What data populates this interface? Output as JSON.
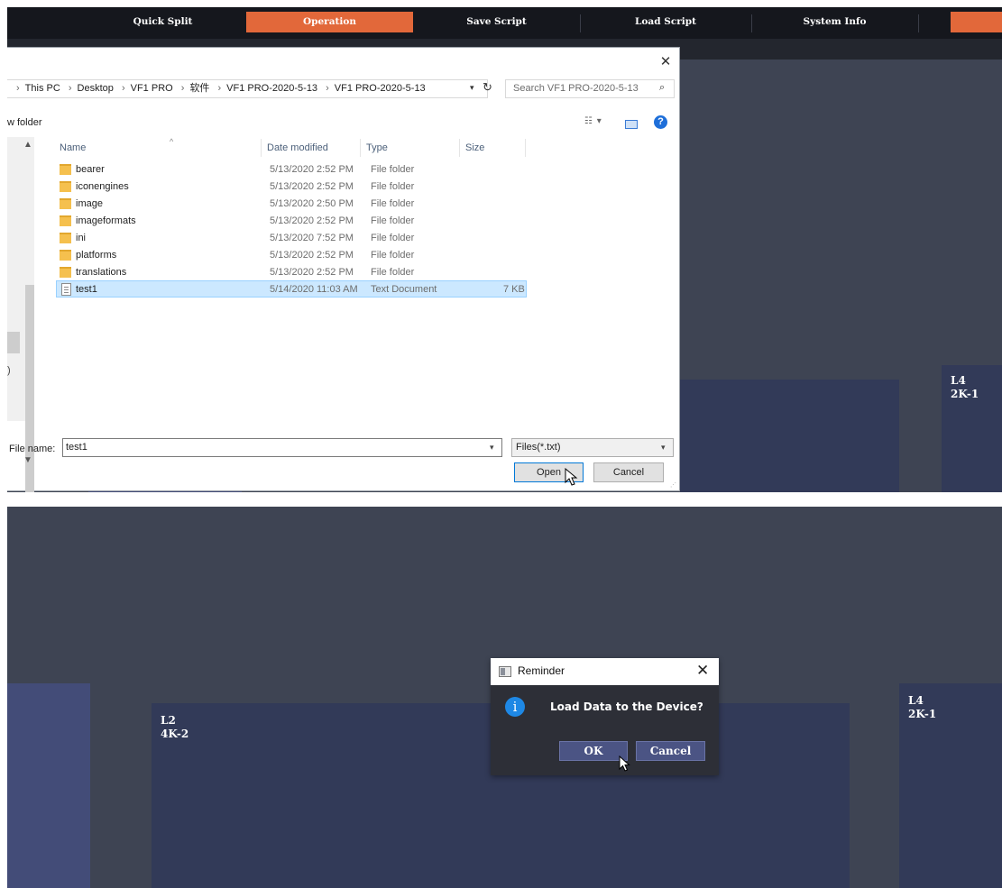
{
  "menu": {
    "tabs": [
      {
        "label": "Quick Split"
      },
      {
        "label": "Operation"
      },
      {
        "label": "Save Script"
      },
      {
        "label": "Load Script"
      },
      {
        "label": "System Info"
      }
    ]
  },
  "colors": {
    "accent": "#e2683a",
    "canvas": "#3e4453",
    "menubar": "#15171d",
    "layer_dark": "#323a58",
    "layer_light": "#434c78"
  },
  "top_layers": {
    "l4_label": "L4\n2K-1"
  },
  "file_dialog": {
    "breadcrumb": [
      "This PC",
      "Desktop",
      "VF1 PRO",
      "软件",
      "VF1 PRO-2020-5-13",
      "VF1 PRO-2020-5-13"
    ],
    "search_placeholder": "Search VF1 PRO-2020-5-13",
    "new_folder_label": "w folder",
    "nav_partial": ")",
    "columns": [
      "Name",
      "Date modified",
      "Type",
      "Size"
    ],
    "files": [
      {
        "name": "bearer",
        "date": "5/13/2020 2:52 PM",
        "type": "File folder",
        "size": "",
        "icon": "folder-icon"
      },
      {
        "name": "iconengines",
        "date": "5/13/2020 2:52 PM",
        "type": "File folder",
        "size": "",
        "icon": "folder-icon"
      },
      {
        "name": "image",
        "date": "5/13/2020 2:50 PM",
        "type": "File folder",
        "size": "",
        "icon": "folder-icon"
      },
      {
        "name": "imageformats",
        "date": "5/13/2020 2:52 PM",
        "type": "File folder",
        "size": "",
        "icon": "folder-icon"
      },
      {
        "name": "ini",
        "date": "5/13/2020 7:52 PM",
        "type": "File folder",
        "size": "",
        "icon": "folder-icon"
      },
      {
        "name": "platforms",
        "date": "5/13/2020 2:52 PM",
        "type": "File folder",
        "size": "",
        "icon": "folder-icon"
      },
      {
        "name": "translations",
        "date": "5/13/2020 2:52 PM",
        "type": "File folder",
        "size": "",
        "icon": "folder-icon"
      },
      {
        "name": "test1",
        "date": "5/14/2020 11:03 AM",
        "type": "Text Document",
        "size": "7 KB",
        "icon": "text-document-icon",
        "selected": true
      }
    ],
    "file_name_label": "File name:",
    "file_name_value": "test1",
    "file_type_value": "Files(*.txt)",
    "open_label": "Open",
    "cancel_label": "Cancel"
  },
  "bottom_layers": {
    "l2_label": "L2\n4K-2",
    "l4_label": "L4\n2K-1"
  },
  "reminder": {
    "title": "Reminder",
    "message": "Load Data to the Device?",
    "ok_label": "OK",
    "cancel_label": "Cancel"
  }
}
